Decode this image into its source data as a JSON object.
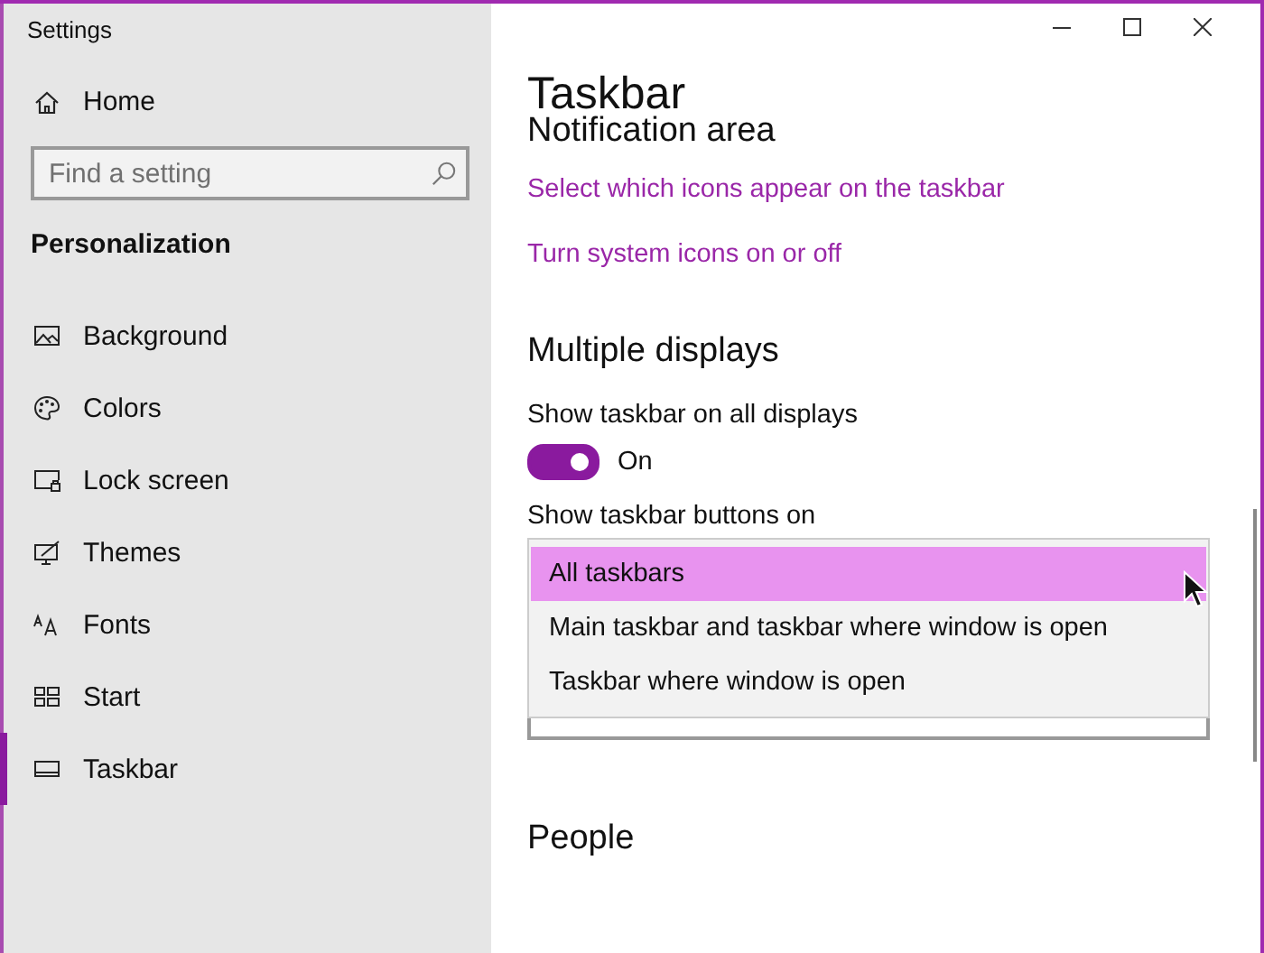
{
  "window": {
    "title": "Settings"
  },
  "sidebar": {
    "home": "Home",
    "search": {
      "placeholder": "Find a setting"
    },
    "section": "Personalization",
    "items": [
      {
        "label": "Background",
        "selected": false
      },
      {
        "label": "Colors",
        "selected": false
      },
      {
        "label": "Lock screen",
        "selected": false
      },
      {
        "label": "Themes",
        "selected": false
      },
      {
        "label": "Fonts",
        "selected": false
      },
      {
        "label": "Start",
        "selected": false
      },
      {
        "label": "Taskbar",
        "selected": true
      }
    ]
  },
  "page": {
    "title": "Taskbar",
    "notification_area": {
      "heading": "Notification area",
      "links": [
        "Select which icons appear on the taskbar",
        "Turn system icons on or off"
      ]
    },
    "multiple_displays": {
      "heading": "Multiple displays",
      "toggle": {
        "label": "Show taskbar on all displays",
        "on": true,
        "state_text": "On"
      },
      "dropdown": {
        "label": "Show taskbar buttons on",
        "options": [
          {
            "label": "All taskbars",
            "selected": true
          },
          {
            "label": "Main taskbar and taskbar where window is open",
            "selected": false
          },
          {
            "label": "Taskbar where window is open",
            "selected": false
          }
        ]
      }
    },
    "people": {
      "heading": "People"
    }
  }
}
